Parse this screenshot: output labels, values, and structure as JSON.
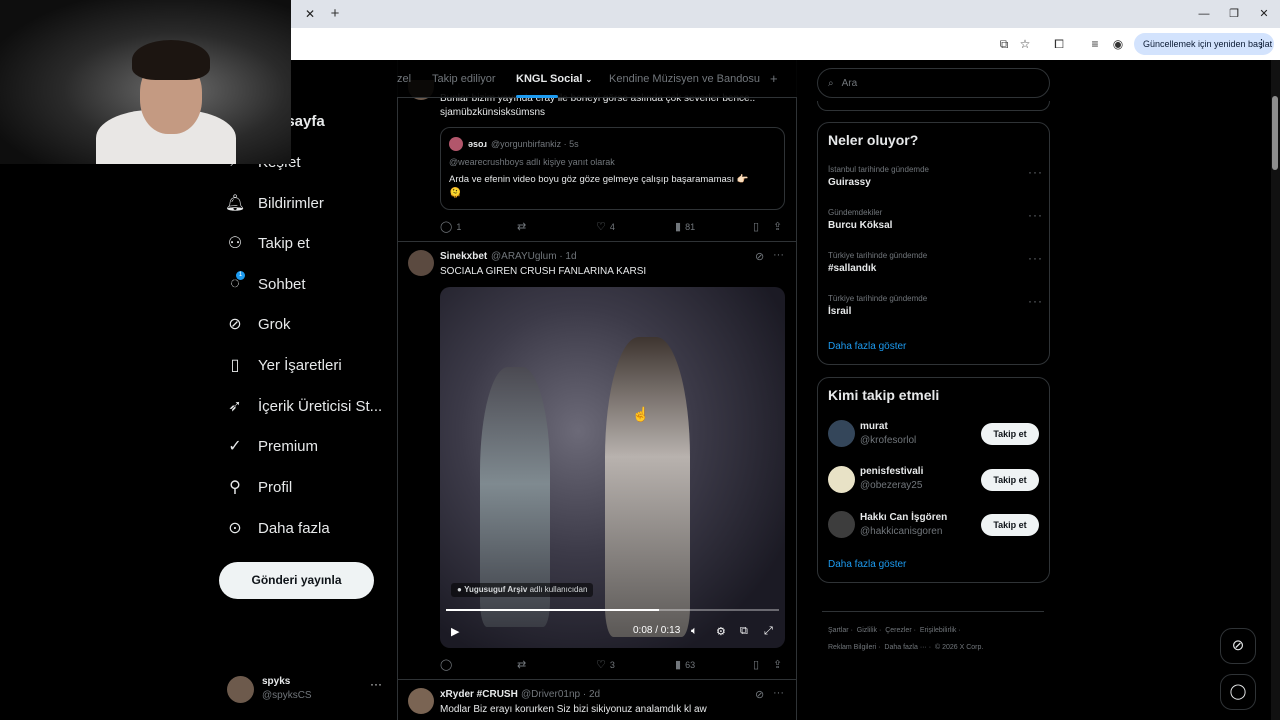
{
  "browser": {
    "update_label": "Güncellemek için yeniden başlat",
    "close_tab": "✕",
    "new_tab": "+"
  },
  "nav": {
    "items": [
      {
        "label": "Anasayfa",
        "icon": "home-icon"
      },
      {
        "label": "Keşfet",
        "icon": "search-icon"
      },
      {
        "label": "Bildirimler",
        "icon": "bell-icon"
      },
      {
        "label": "Takip et",
        "icon": "follow-icon"
      },
      {
        "label": "Sohbet",
        "icon": "chat-icon"
      },
      {
        "label": "Grok",
        "icon": "grok-icon"
      },
      {
        "label": "Yer İşaretleri",
        "icon": "bookmark-icon"
      },
      {
        "label": "İçerik Üreticisi St...",
        "icon": "rocket-icon"
      },
      {
        "label": "Premium",
        "icon": "verified-icon"
      },
      {
        "label": "Profil",
        "icon": "person-icon"
      },
      {
        "label": "Daha fazla",
        "icon": "more-circle-icon"
      }
    ],
    "chat_badge": "1",
    "post_button": "Gönderi yayınla",
    "account": {
      "name": "spyks",
      "handle": "@spyksCS"
    }
  },
  "tabs": [
    {
      "label": "zel"
    },
    {
      "label": "Takip ediliyor"
    },
    {
      "label": "KNGL Social",
      "active": true
    },
    {
      "label": "Kendine Müzisyen ve Bandosu"
    }
  ],
  "post1": {
    "text_line1": "Bunlar bizim yayında eray ile boneyi görse aslında çok severler bence..",
    "text_line2": "sjamübzkünsisksümsns",
    "quote": {
      "name": "əsoɹ",
      "handle": "@yorgunbirfankiz · 5s",
      "reply_to": "@wearecrushboys adlı kişiye yanıt olarak",
      "text": "Arda ve efenin video boyu göz göze gelmeye çalışıp başaramaması 👉🏻",
      "emoji": "🫠"
    },
    "actions": {
      "replies": "1",
      "likes": "4",
      "views": "81"
    }
  },
  "post2": {
    "name": "Sinekxbet",
    "handle": "@ARAYUglum · 1d",
    "text": "SOCIALA GIREN CRUSH FANLARINA KARSI",
    "video": {
      "credit_name": "Yugusuguf Arşiv",
      "credit_suffix": "adlı kullanıcıdan",
      "time": "0:08 / 0:13",
      "progress": 0.64
    },
    "actions": {
      "replies": "",
      "likes": "3",
      "views": "63"
    }
  },
  "post3": {
    "name": "xRyder #CRUSH",
    "handle": "@Driver01np · 2d",
    "text": "Modlar Biz erayı korurken Siz bizi sikiyonuz analamdık kl aw"
  },
  "search": {
    "placeholder": "Ara"
  },
  "trends": {
    "title": "Neler oluyor?",
    "items": [
      {
        "category": "İstanbul tarihinde gündemde",
        "name": "Guirassy"
      },
      {
        "category": "Gündemdekiler",
        "name": "Burcu Köksal"
      },
      {
        "category": "Türkiye tarihinde gündemde",
        "name": "#sallandık"
      },
      {
        "category": "Türkiye tarihinde gündemde",
        "name": "İsrail"
      }
    ],
    "show_more": "Daha fazla göster"
  },
  "who_to_follow": {
    "title": "Kimi takip etmeli",
    "users": [
      {
        "name": "murat",
        "handle": "@krofesorlol",
        "button": "Takip et"
      },
      {
        "name": "penisfestivali",
        "handle": "@obezeray25",
        "button": "Takip et"
      },
      {
        "name": "Hakkı Can İşgören",
        "handle": "@hakkicanisgoren",
        "button": "Takip et"
      }
    ],
    "show_more": "Daha fazla göster"
  },
  "footer": {
    "line1": [
      "Şartlar",
      "Gizlilik",
      "Çerezler",
      "Erişilebilirlik"
    ],
    "line2": [
      "Reklam Bilgileri",
      "Daha fazla ···",
      "© 2026 X Corp."
    ]
  },
  "colors": {
    "accent": "#1d9bf0",
    "background": "#000000",
    "text": "#e7e9ea",
    "muted": "#71767b"
  }
}
